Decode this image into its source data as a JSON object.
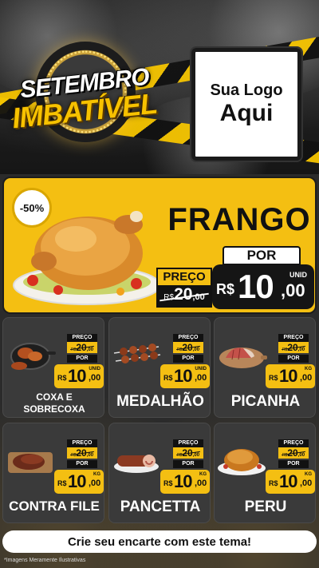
{
  "header": {
    "badge_line1": "SETEMBRO",
    "badge_line2": "IMBATÍVEL",
    "logo_line1": "Sua Logo",
    "logo_line2": "Aqui"
  },
  "hero": {
    "discount": "-50%",
    "name": "FRANGO",
    "preco_label": "PREÇO",
    "old_currency": "R$",
    "old_int": "20",
    "old_dec": ",00",
    "por_label": "POR",
    "currency": "R$",
    "price_int": "10",
    "price_dec": ",00",
    "unit": "UNID",
    "image_icon": "roast-chicken-icon"
  },
  "products": [
    {
      "name_line1": "COXA E",
      "name_line2": "SOBRECOXA",
      "preco_label": "PREÇO",
      "old_currency": "R$",
      "old_int": "20",
      "old_dec": ",00",
      "por_label": "POR",
      "currency": "R$",
      "price_int": "10",
      "price_dec": ",00",
      "unit": "UNID",
      "image_icon": "chicken-thigh-pan-icon"
    },
    {
      "name_line1": "MEDALHÃO",
      "name_line2": "",
      "preco_label": "PREÇO",
      "old_currency": "R$",
      "old_int": "20",
      "old_dec": ",00",
      "por_label": "POR",
      "currency": "R$",
      "price_int": "10",
      "price_dec": ",00",
      "unit": "UNID",
      "image_icon": "skewers-icon"
    },
    {
      "name_line1": "PICANHA",
      "name_line2": "",
      "preco_label": "PREÇO",
      "old_currency": "R$",
      "old_int": "20",
      "old_dec": ",00",
      "por_label": "POR",
      "currency": "R$",
      "price_int": "10",
      "price_dec": ",00",
      "unit": "KG",
      "image_icon": "sliced-beef-board-icon"
    },
    {
      "name_line1": "CONTRA FILE",
      "name_line2": "",
      "preco_label": "PREÇO",
      "old_currency": "R$",
      "old_int": "20",
      "old_dec": ",00",
      "por_label": "POR",
      "currency": "R$",
      "price_int": "10",
      "price_dec": ",00",
      "unit": "KG",
      "image_icon": "steak-board-icon"
    },
    {
      "name_line1": "PANCETTA",
      "name_line2": "",
      "preco_label": "PREÇO",
      "old_currency": "R$",
      "old_int": "20",
      "old_dec": ",00",
      "por_label": "POR",
      "currency": "R$",
      "price_int": "10",
      "price_dec": ",00",
      "unit": "KG",
      "image_icon": "pancetta-roll-icon"
    },
    {
      "name_line1": "PERU",
      "name_line2": "",
      "preco_label": "PREÇO",
      "old_currency": "R$",
      "old_int": "20",
      "old_dec": ",00",
      "por_label": "POR",
      "currency": "R$",
      "price_int": "10",
      "price_dec": ",00",
      "unit": "KG",
      "image_icon": "roast-turkey-icon"
    }
  ],
  "footer": {
    "cta": "Crie seu encarte com este tema!",
    "disclaimer": "*Imagens Meramente Ilustrativas"
  },
  "colors": {
    "accent_yellow": "#f4bf12",
    "card_bg": "#3a3a3a",
    "dark": "#151515"
  }
}
